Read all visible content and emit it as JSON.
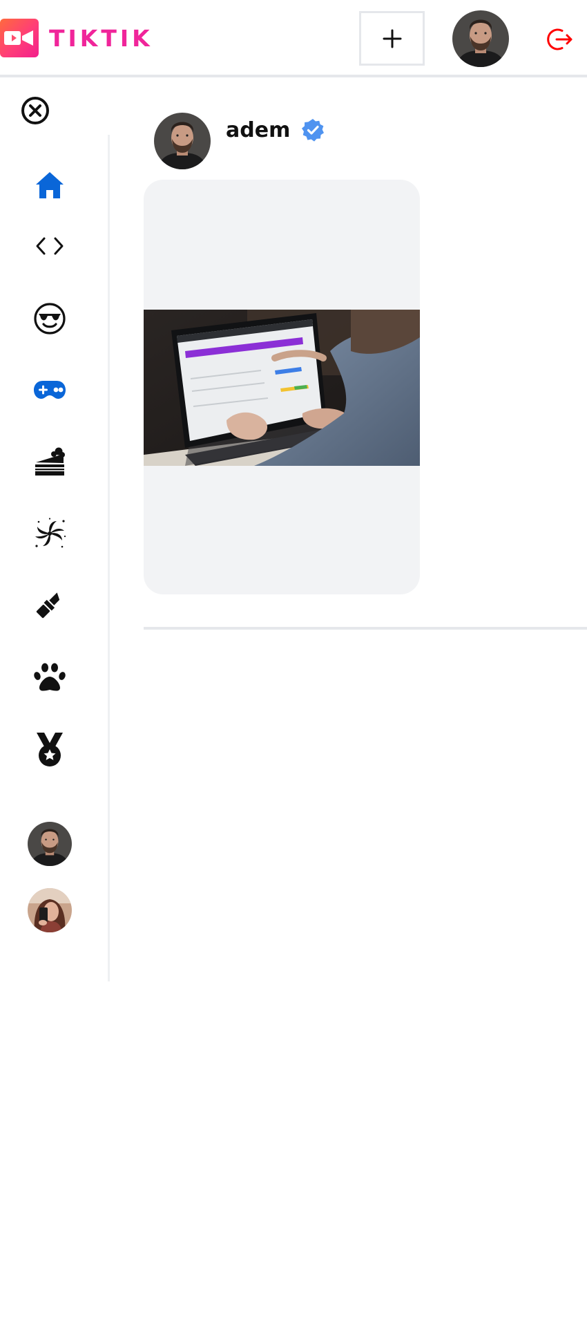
{
  "header": {
    "logo_text": "TIKTIK",
    "logo_icon": "video-camera-icon",
    "upload_icon": "plus-icon",
    "logout_icon": "logout-icon",
    "brand_color": "#f0259a",
    "logout_color": "#ff0000"
  },
  "sidebar": {
    "close_icon": "close-circle-icon",
    "active_color": "#0a66d8",
    "topics": [
      {
        "icon": "home-icon",
        "active": true
      },
      {
        "icon": "code-icon",
        "active": false
      },
      {
        "icon": "sunglasses-face-icon",
        "active": false
      },
      {
        "icon": "gamepad-icon",
        "active": true
      },
      {
        "icon": "cake-icon",
        "active": false
      },
      {
        "icon": "dance-swirl-icon",
        "active": false
      },
      {
        "icon": "lipstick-icon",
        "active": false
      },
      {
        "icon": "paw-icon",
        "active": false
      },
      {
        "icon": "medal-icon",
        "active": false
      }
    ],
    "accounts": [
      {
        "avatar": "bearded-man-avatar"
      },
      {
        "avatar": "woman-selfie-avatar"
      }
    ]
  },
  "feed": {
    "posts": [
      {
        "username": "adem",
        "verified": true,
        "verified_icon": "verified-badge-icon",
        "verified_color": "#4f93f0",
        "video_thumbnail": "laptop-typing-thumbnail"
      }
    ]
  }
}
